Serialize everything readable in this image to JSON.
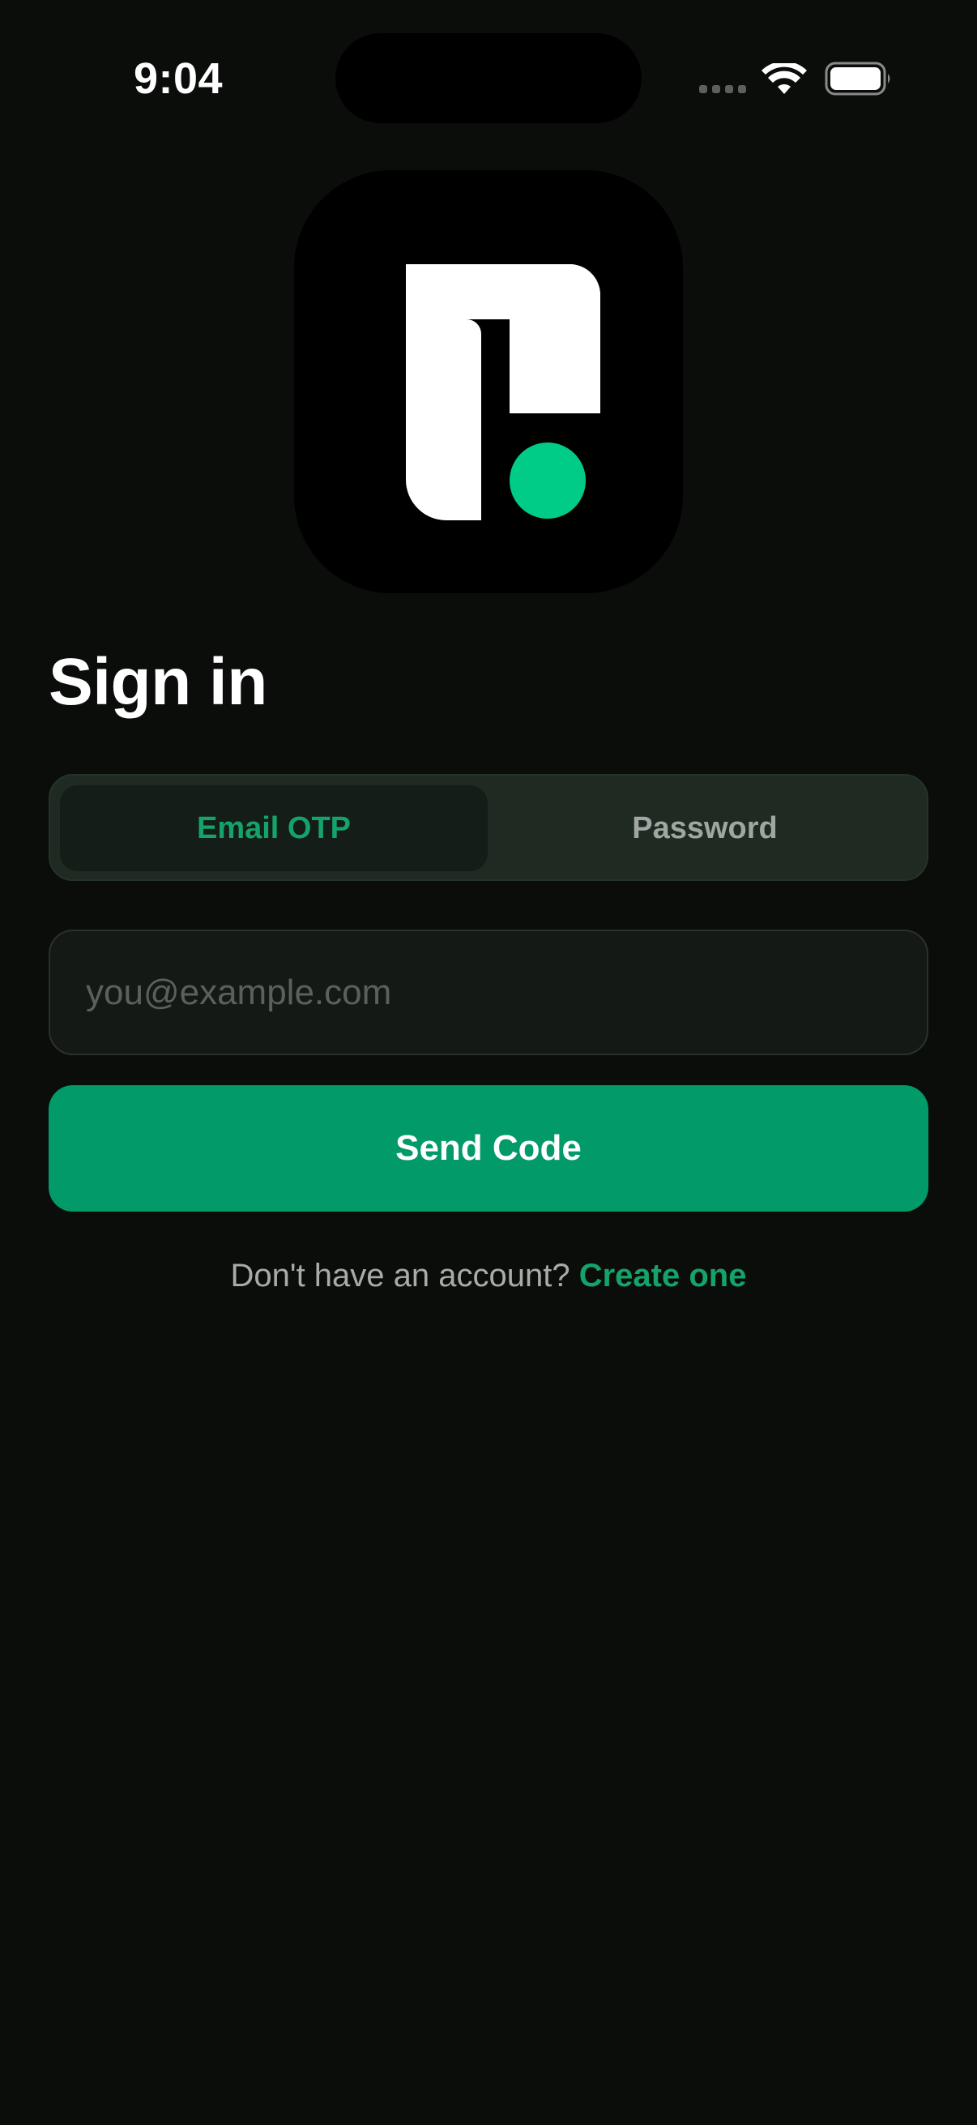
{
  "status_bar": {
    "time": "9:04"
  },
  "signin": {
    "title": "Sign in",
    "tabs": [
      {
        "label": "Email OTP",
        "selected": true
      },
      {
        "label": "Password",
        "selected": false
      }
    ],
    "email_placeholder": "you@example.com",
    "email_value": "",
    "submit_label": "Send Code",
    "footer_prompt": "Don't have an account?",
    "footer_link": "Create one"
  },
  "icons": {
    "logo": "app-logo",
    "wifi": "wifi-icon",
    "battery": "battery-icon",
    "signal": "cellular-signal-icon"
  },
  "colors": {
    "background": "#0b0d0b",
    "accent": "#029a68",
    "accent_text": "#14a36b",
    "logo_dot": "#00cc88"
  }
}
